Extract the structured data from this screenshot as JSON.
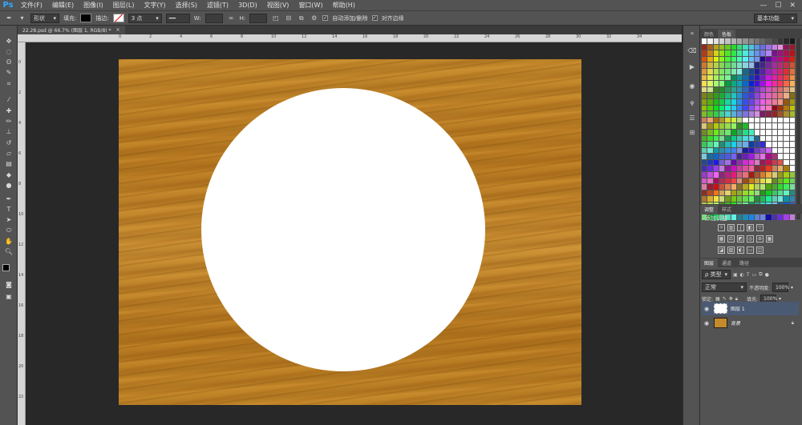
{
  "menu": {
    "logo": "Ps",
    "items": [
      "文件(F)",
      "编辑(E)",
      "图像(I)",
      "图层(L)",
      "文字(Y)",
      "选择(S)",
      "滤镜(T)",
      "3D(D)",
      "视图(V)",
      "窗口(W)",
      "帮助(H)"
    ],
    "window_controls": [
      "—",
      "☐",
      "✕"
    ]
  },
  "options": {
    "mode": "形状",
    "fill_label": "填充:",
    "stroke_label": "描边:",
    "stroke_width": "3 点",
    "w_label": "W:",
    "h_label": "H:",
    "auto_add_delete": "自动添加/删除",
    "align_edges": "对齐边缘",
    "workspace": "基本功能"
  },
  "document_tab": {
    "title": "22.28.psd @ 66.7% (图层 1, RGB/8) *",
    "close": "×"
  },
  "ruler_top": [
    "0",
    "2",
    "4",
    "6",
    "8",
    "10",
    "12",
    "14",
    "16",
    "18",
    "20",
    "22",
    "24",
    "26",
    "28",
    "30",
    "32",
    "34"
  ],
  "ruler_left": [
    "0",
    "2",
    "4",
    "6",
    "8",
    "10",
    "12",
    "14",
    "16",
    "18",
    "20",
    "22"
  ],
  "swatches_panel": {
    "tabs": [
      "颜色",
      "色板"
    ]
  },
  "adjustments_panel": {
    "tabs": [
      "调整",
      "样式"
    ],
    "title": "添加调整"
  },
  "layers_panel": {
    "tabs": [
      "图层",
      "通道",
      "路径"
    ],
    "filter": "ρ 类型",
    "blend_mode": "正常",
    "opacity_label": "不透明度:",
    "opacity_value": "100%",
    "lock_label": "锁定:",
    "fill_label": "填充:",
    "fill_value": "100%",
    "layers": [
      {
        "name": "图层 1",
        "selected": true
      },
      {
        "name": "背景",
        "selected": false
      }
    ]
  },
  "colors": {
    "wood": "#c48a2c",
    "circle": "#ffffff",
    "panel": "#535353",
    "selected_layer": "#4b5a73"
  }
}
